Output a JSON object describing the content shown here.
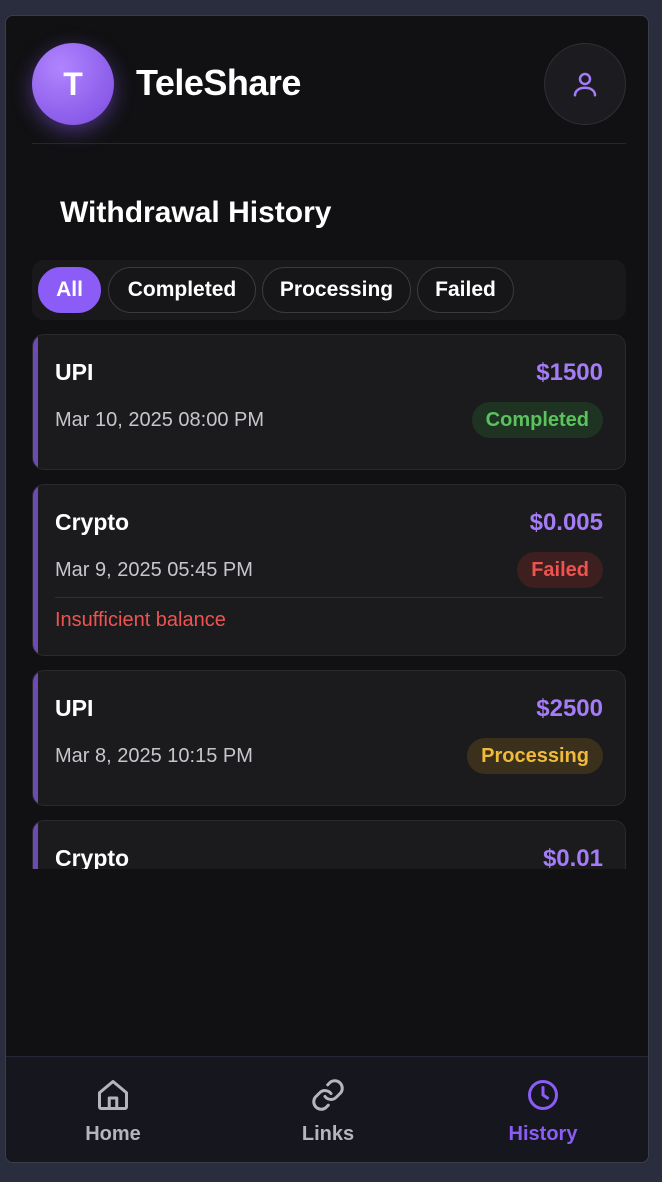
{
  "app": {
    "logo_letter": "T",
    "title": "TeleShare",
    "profile_icon": "user-icon"
  },
  "page": {
    "title": "Withdrawal History"
  },
  "filters": [
    {
      "label": "All",
      "active": true
    },
    {
      "label": "Completed",
      "active": false
    },
    {
      "label": "Processing",
      "active": false
    },
    {
      "label": "Failed",
      "active": false
    }
  ],
  "withdrawals": [
    {
      "method": "UPI",
      "amount": "$1500",
      "date": "Mar 10, 2025 08:00 PM",
      "status": "Completed"
    },
    {
      "method": "Crypto",
      "amount": "$0.005",
      "date": "Mar 9, 2025 05:45 PM",
      "status": "Failed",
      "reason": "Insufficient balance"
    },
    {
      "method": "UPI",
      "amount": "$2500",
      "date": "Mar 8, 2025 10:15 PM",
      "status": "Processing"
    },
    {
      "method": "Crypto",
      "amount": "$0.01"
    }
  ],
  "nav": [
    {
      "label": "Home",
      "icon": "home-icon",
      "active": false
    },
    {
      "label": "Links",
      "icon": "link-icon",
      "active": false
    },
    {
      "label": "History",
      "icon": "clock-icon",
      "active": true
    }
  ],
  "colors": {
    "accent": "#8b5cf6",
    "amount": "#a57cf7",
    "completed": "#5cc25e",
    "failed": "#ef5350",
    "processing": "#f0bb3c",
    "background": "#111113"
  }
}
